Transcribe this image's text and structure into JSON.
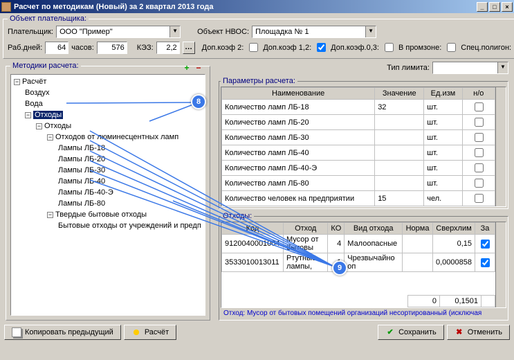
{
  "window": {
    "title": "Расчет по методикам (Новый) за 2 квартал 2013 года"
  },
  "payer": {
    "legend": "Объект плательщика:",
    "payer_label": "Плательщик:",
    "payer_value": "ООО \"Пример\"",
    "object_label": "Объект НВОС:",
    "object_value": "Площадка № 1",
    "work_days_label": "Раб.дней:",
    "work_days": "64",
    "hours_label": "часов:",
    "hours": "576",
    "kez_label": "КЭЗ:",
    "kez": "2,2",
    "dop2_label": "Доп.коэф 2:",
    "dop12_label": "Доп.коэф 1,2:",
    "dop03_label": "Доп.коэф.0,3:",
    "vpromzone_label": "В промзоне:",
    "spec_label": "Спец.полигон:"
  },
  "methods": {
    "legend": "Методики расчета:",
    "limit_label": "Тип лимита:",
    "root": "Расчёт",
    "n_air": "Воздух",
    "n_water": "Вода",
    "n_waste": "Отходы",
    "n_waste2": "Отходы",
    "n_lum": "Отходов от люминесцентных ламп",
    "lamp18": "Лампы ЛБ-18",
    "lamp20": "Лампы ЛБ-20",
    "lamp30": "Лампы ЛБ-30",
    "lamp40": "Лампы ЛБ-40",
    "lamp40e": "Лампы ЛБ-40-Э",
    "lamp80": "Лампы ЛБ-80",
    "n_solid": "Твердые бытовые отходы",
    "n_solid_sub": "Бытовые отходы от учреждений и предп"
  },
  "params": {
    "legend": "Параметры расчета:",
    "col_name": "Наименование",
    "col_val": "Значение",
    "col_unit": "Ед.изм",
    "col_no": "н/о",
    "rows": [
      {
        "name": "Количество ламп ЛБ-18",
        "val": "32",
        "unit": "шт."
      },
      {
        "name": "Количество ламп ЛБ-20",
        "val": "",
        "unit": "шт."
      },
      {
        "name": "Количество ламп ЛБ-30",
        "val": "",
        "unit": "шт."
      },
      {
        "name": "Количество ламп ЛБ-40",
        "val": "",
        "unit": "шт."
      },
      {
        "name": "Количество ламп ЛБ-40-Э",
        "val": "",
        "unit": "шт."
      },
      {
        "name": "Количество ламп ЛБ-80",
        "val": "",
        "unit": "шт."
      },
      {
        "name": "Количество человек на предприятии",
        "val": "15",
        "unit": "чел."
      }
    ]
  },
  "wastes": {
    "legend": "Отходы:",
    "col_code": "Код",
    "col_waste": "Отход",
    "col_ko": "КО",
    "col_type": "Вид отхода",
    "col_norm": "Норма",
    "col_over": "Сверхлим",
    "col_za": "За",
    "rows": [
      {
        "code": "9120040001004",
        "waste": "Мусор от бытовы",
        "ko": "4",
        "type": "Малоопасные",
        "norm": "",
        "over": "0,15",
        "za": true
      },
      {
        "code": "3533010013011",
        "waste": "Ртутные лампы,",
        "ko": "1",
        "type": "Чрезвычайно оп",
        "norm": "",
        "over": "0,0000858",
        "za": true
      }
    ],
    "sum_norm": "0",
    "sum_over": "0,1501",
    "status": "Отход: Мусор от бытовых помещений организаций несортированный (исключая"
  },
  "buttons": {
    "copy_prev": "Копировать предыдущий",
    "calc": "Расчёт",
    "save": "Сохранить",
    "cancel": "Отменить"
  },
  "annot": {
    "a8": "8",
    "a9": "9"
  }
}
